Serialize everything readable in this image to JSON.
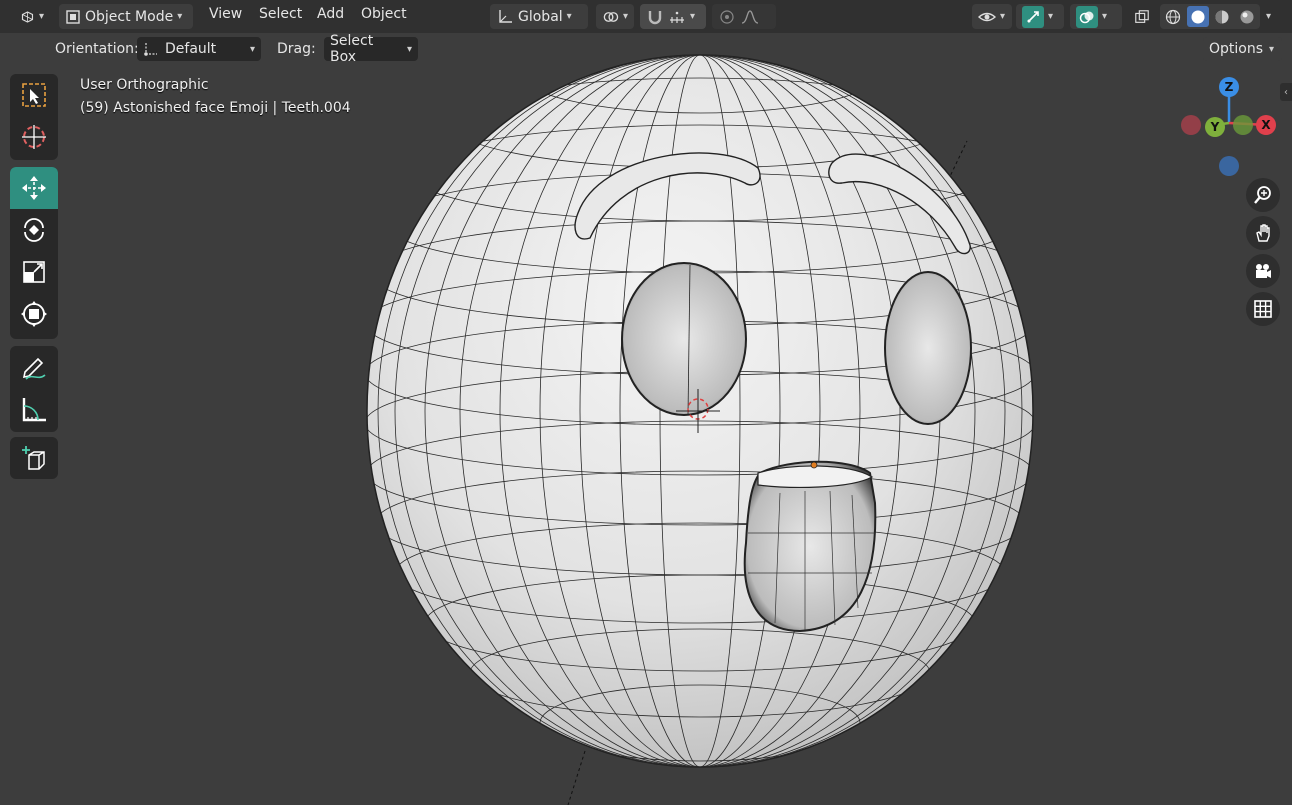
{
  "header": {
    "editor_type_icon": "3d-viewport-icon",
    "mode_label": "Object Mode",
    "menus": [
      "View",
      "Select",
      "Add",
      "Object"
    ],
    "transform_orientation": "Global",
    "shading_modes": [
      "wireframe",
      "solid",
      "material-preview",
      "rendered"
    ],
    "active_shading": "solid"
  },
  "tool_settings": {
    "orientation_label": "Orientation:",
    "orientation_value": "Default",
    "drag_label": "Drag:",
    "drag_value": "Select Box",
    "options_label": "Options"
  },
  "viewport": {
    "view_name": "User Orthographic",
    "object_info": "(59) Astonished face Emoji | Teeth.004"
  },
  "toolbar": {
    "tools": [
      "select-box",
      "cursor",
      "move",
      "rotate",
      "scale",
      "transform",
      "annotate",
      "measure",
      "add-cube"
    ],
    "active_tool": "move"
  },
  "gizmo": {
    "axes": [
      "Z",
      "Y",
      "X"
    ],
    "colors": {
      "x": "#e0404c",
      "y": "#7fb03c",
      "z": "#3a8ee6"
    }
  },
  "navigation": [
    "zoom",
    "pan",
    "camera",
    "ortho-grid"
  ]
}
